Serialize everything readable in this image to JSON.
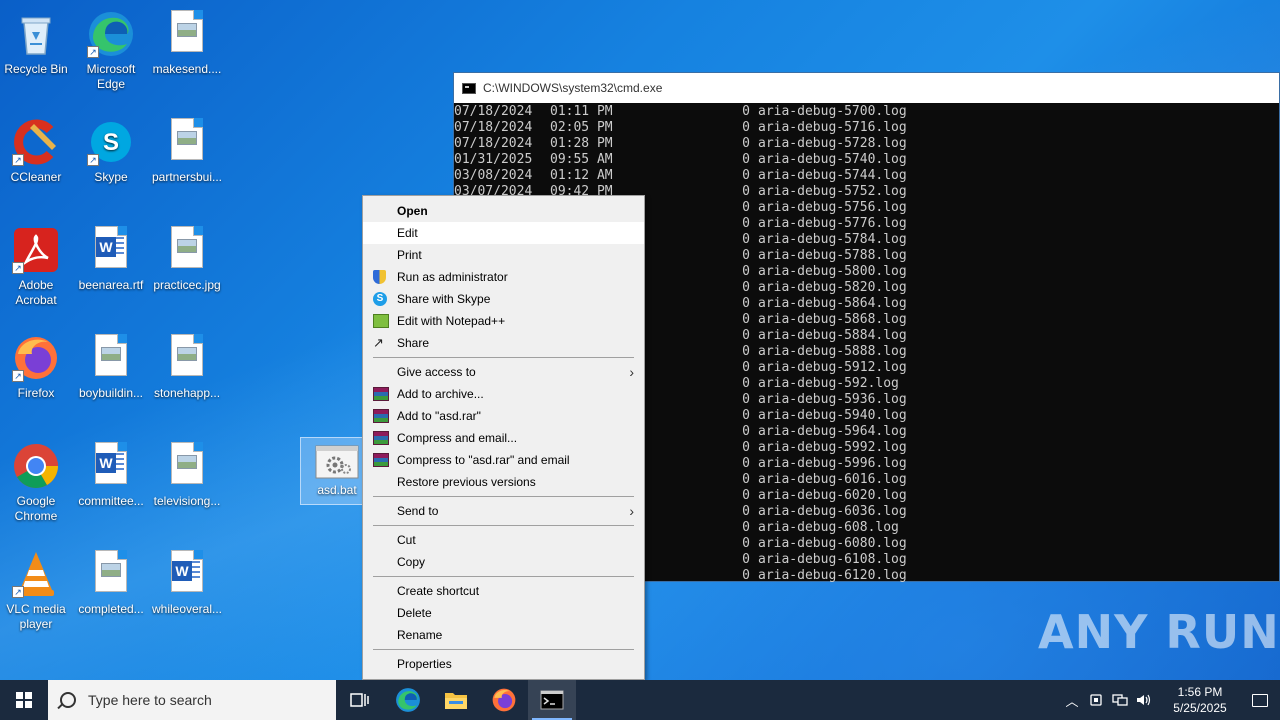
{
  "desktop": {
    "icons": [
      {
        "label": "Recycle Bin",
        "type": "recycle-bin"
      },
      {
        "label": "Microsoft Edge",
        "type": "edge"
      },
      {
        "label": "makesend....",
        "type": "image-file"
      },
      {
        "label": "CCleaner",
        "type": "ccleaner"
      },
      {
        "label": "Skype",
        "type": "skype"
      },
      {
        "label": "partnersbui...",
        "type": "image-file"
      },
      {
        "label": "Adobe Acrobat",
        "type": "acrobat"
      },
      {
        "label": "beenarea.rtf",
        "type": "word-file"
      },
      {
        "label": "practicec.jpg",
        "type": "image-file"
      },
      {
        "label": "Firefox",
        "type": "firefox"
      },
      {
        "label": "boybuildin...",
        "type": "image-file"
      },
      {
        "label": "stonehapp...",
        "type": "image-file"
      },
      {
        "label": "Google Chrome",
        "type": "chrome"
      },
      {
        "label": "committee...",
        "type": "word-file"
      },
      {
        "label": "televisiong...",
        "type": "image-file"
      },
      {
        "label": "VLC media player",
        "type": "vlc"
      },
      {
        "label": "completed...",
        "type": "image-file"
      },
      {
        "label": "whileoveral...",
        "type": "word-file"
      },
      {
        "label": "asd.bat",
        "type": "batch-file"
      }
    ]
  },
  "cmd": {
    "title": "C:\\WINDOWS\\system32\\cmd.exe",
    "lines": [
      {
        "date": "07/18/2024",
        "time": "01:11 PM",
        "size": "0",
        "name": "aria-debug-5700.log"
      },
      {
        "date": "07/18/2024",
        "time": "02:05 PM",
        "size": "0",
        "name": "aria-debug-5716.log"
      },
      {
        "date": "07/18/2024",
        "time": "01:28 PM",
        "size": "0",
        "name": "aria-debug-5728.log"
      },
      {
        "date": "01/31/2025",
        "time": "09:55 AM",
        "size": "0",
        "name": "aria-debug-5740.log"
      },
      {
        "date": "03/08/2024",
        "time": "01:12 AM",
        "size": "0",
        "name": "aria-debug-5744.log"
      },
      {
        "date": "03/07/2024",
        "time": "09:42 PM",
        "size": "0",
        "name": "aria-debug-5752.log"
      },
      {
        "date": "",
        "time": "",
        "size": "0",
        "name": "aria-debug-5756.log"
      },
      {
        "date": "",
        "time": "",
        "size": "0",
        "name": "aria-debug-5776.log"
      },
      {
        "date": "",
        "time": "",
        "size": "0",
        "name": "aria-debug-5784.log"
      },
      {
        "date": "",
        "time": "",
        "size": "0",
        "name": "aria-debug-5788.log"
      },
      {
        "date": "",
        "time": "",
        "size": "0",
        "name": "aria-debug-5800.log"
      },
      {
        "date": "",
        "time": "",
        "size": "0",
        "name": "aria-debug-5820.log"
      },
      {
        "date": "",
        "time": "",
        "size": "0",
        "name": "aria-debug-5864.log"
      },
      {
        "date": "",
        "time": "",
        "size": "0",
        "name": "aria-debug-5868.log"
      },
      {
        "date": "",
        "time": "",
        "size": "0",
        "name": "aria-debug-5884.log"
      },
      {
        "date": "",
        "time": "",
        "size": "0",
        "name": "aria-debug-5888.log"
      },
      {
        "date": "",
        "time": "",
        "size": "0",
        "name": "aria-debug-5912.log"
      },
      {
        "date": "",
        "time": "",
        "size": "0",
        "name": "aria-debug-592.log"
      },
      {
        "date": "",
        "time": "",
        "size": "0",
        "name": "aria-debug-5936.log"
      },
      {
        "date": "",
        "time": "",
        "size": "0",
        "name": "aria-debug-5940.log"
      },
      {
        "date": "",
        "time": "",
        "size": "0",
        "name": "aria-debug-5964.log"
      },
      {
        "date": "",
        "time": "",
        "size": "0",
        "name": "aria-debug-5992.log"
      },
      {
        "date": "",
        "time": "",
        "size": "0",
        "name": "aria-debug-5996.log"
      },
      {
        "date": "",
        "time": "",
        "size": "0",
        "name": "aria-debug-6016.log"
      },
      {
        "date": "",
        "time": "",
        "size": "0",
        "name": "aria-debug-6020.log"
      },
      {
        "date": "",
        "time": "",
        "size": "0",
        "name": "aria-debug-6036.log"
      },
      {
        "date": "",
        "time": "",
        "size": "0",
        "name": "aria-debug-608.log"
      },
      {
        "date": "",
        "time": "",
        "size": "0",
        "name": "aria-debug-6080.log"
      },
      {
        "date": "",
        "time": "",
        "size": "0",
        "name": "aria-debug-6108.log"
      },
      {
        "date": "",
        "time": "",
        "size": "0",
        "name": "aria-debug-6120.log"
      }
    ]
  },
  "context_menu": {
    "items": [
      {
        "label": "Open",
        "bold": true,
        "icon": "",
        "submenu": false
      },
      {
        "label": "Edit",
        "hover": true,
        "icon": "",
        "submenu": false
      },
      {
        "label": "Print",
        "icon": "",
        "submenu": false
      },
      {
        "label": "Run as administrator",
        "icon": "shield-icon",
        "submenu": false
      },
      {
        "label": "Share with Skype",
        "icon": "skype-icon",
        "submenu": false
      },
      {
        "label": "Edit with Notepad++",
        "icon": "notepadpp-icon",
        "submenu": false
      },
      {
        "label": "Share",
        "icon": "share-icon",
        "submenu": false
      },
      {
        "separator": true
      },
      {
        "label": "Give access to",
        "icon": "",
        "submenu": true
      },
      {
        "label": "Add to archive...",
        "icon": "winrar-icon",
        "submenu": false
      },
      {
        "label": "Add to \"asd.rar\"",
        "icon": "winrar-icon",
        "submenu": false
      },
      {
        "label": "Compress and email...",
        "icon": "winrar-icon",
        "submenu": false
      },
      {
        "label": "Compress to \"asd.rar\" and email",
        "icon": "winrar-icon",
        "submenu": false
      },
      {
        "label": "Restore previous versions",
        "icon": "",
        "submenu": false
      },
      {
        "separator": true
      },
      {
        "label": "Send to",
        "icon": "",
        "submenu": true
      },
      {
        "separator": true
      },
      {
        "label": "Cut",
        "icon": "",
        "submenu": false
      },
      {
        "label": "Copy",
        "icon": "",
        "submenu": false
      },
      {
        "separator": true
      },
      {
        "label": "Create shortcut",
        "icon": "",
        "submenu": false
      },
      {
        "label": "Delete",
        "icon": "",
        "submenu": false
      },
      {
        "label": "Rename",
        "icon": "",
        "submenu": false
      },
      {
        "separator": true
      },
      {
        "label": "Properties",
        "icon": "",
        "submenu": false
      }
    ]
  },
  "taskbar": {
    "search_placeholder": "Type here to search",
    "time": "1:56 PM",
    "date": "5/25/2025"
  },
  "watermark": "ANY RUN",
  "colors": {
    "taskbar": "#1b2a3e",
    "cmd_background": "#0c0c0c",
    "menu_background": "#f0f0f0",
    "wallpaper": "#1682e0"
  }
}
